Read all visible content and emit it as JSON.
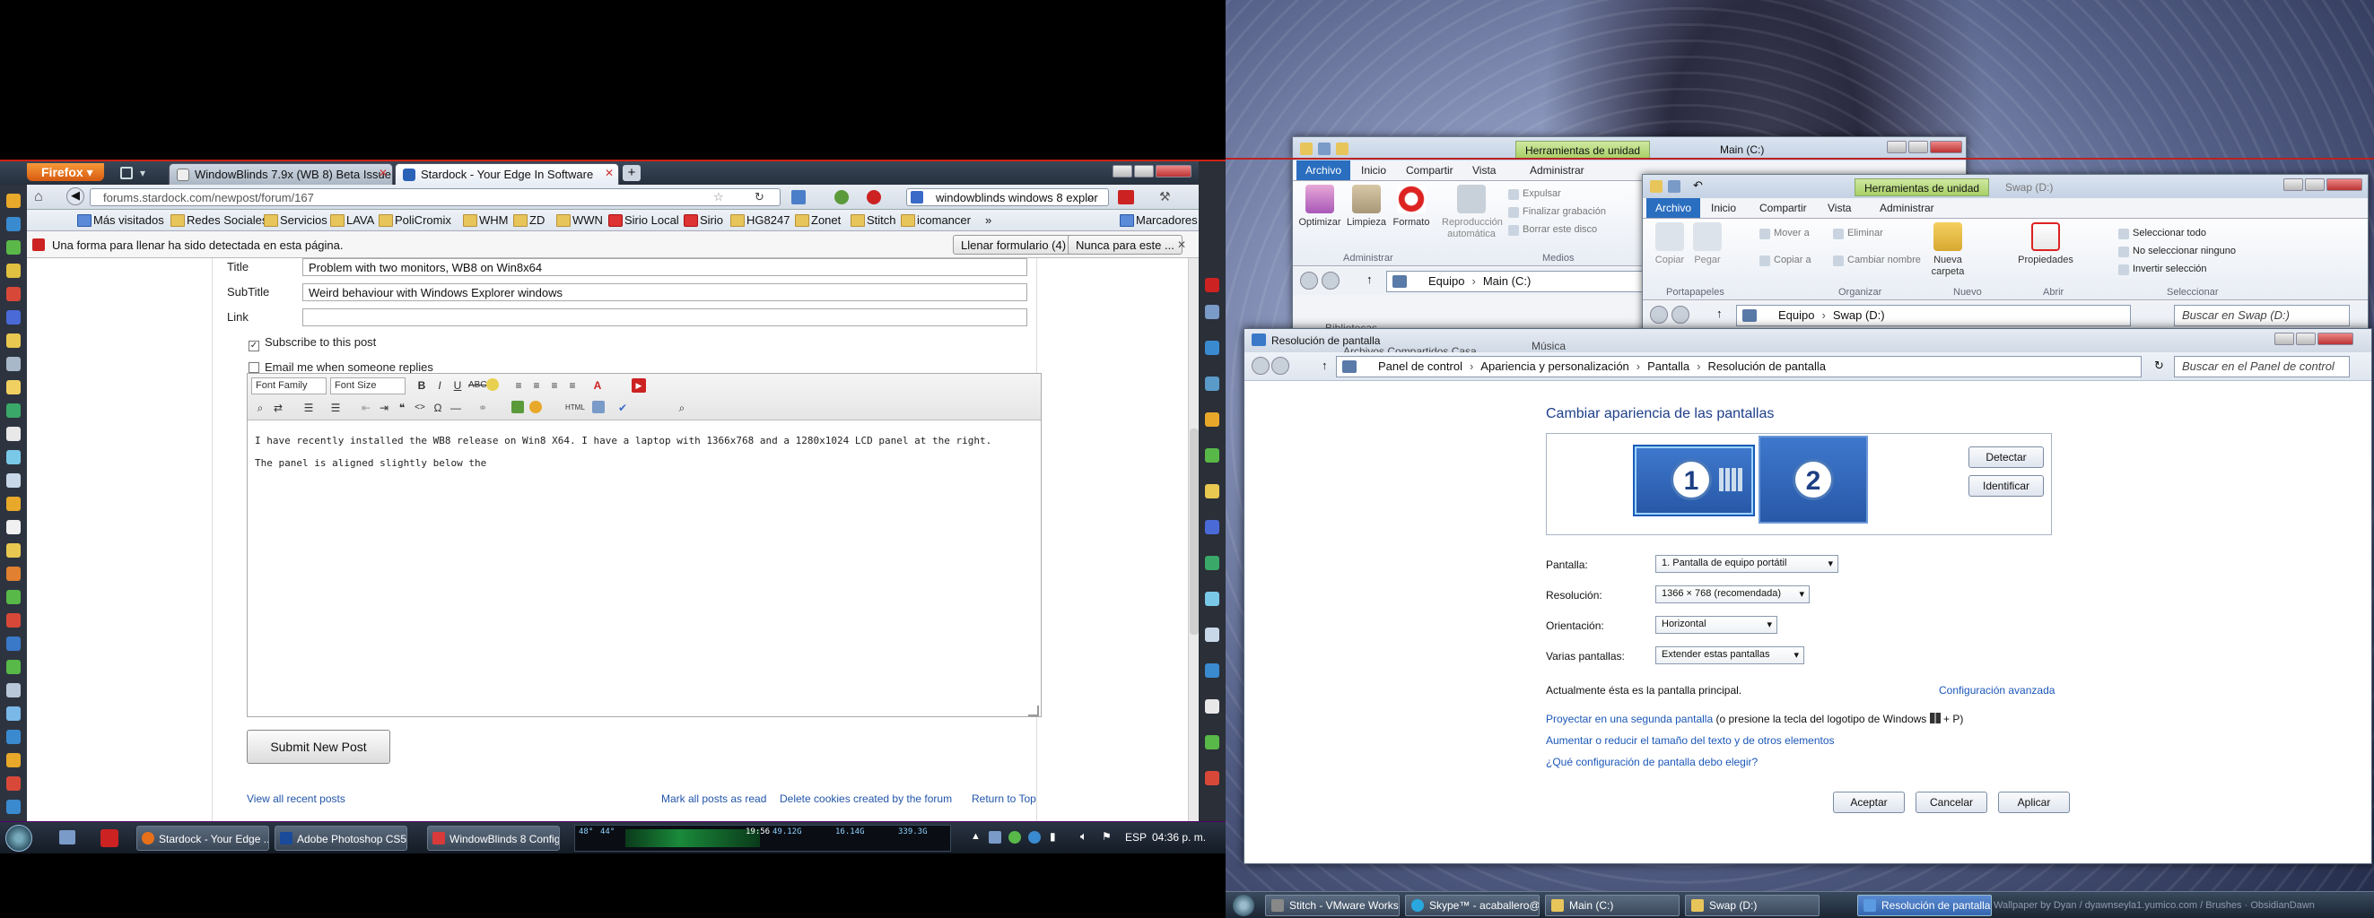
{
  "firefox": {
    "menu_button": "Firefox",
    "tabs": [
      {
        "label": "WindowBlinds 7.9x (WB 8) Beta Issue ..."
      },
      {
        "label": "Stardock - Your Edge In Software"
      }
    ],
    "url": "forums.stardock.com/newpost/forum/167",
    "search_text": "windowblinds windows 8 explor",
    "bookmarks": [
      "Más visitados",
      "Redes Sociales",
      "Servicios",
      "LAVA",
      "PoliCromix",
      "WHM",
      "ZD",
      "WWN",
      "Sirio Local",
      "Sirio",
      "HG8247",
      "Zonet",
      "Stitch",
      "icomancer"
    ],
    "bookmarks_menu": "Marcadores",
    "notification": {
      "text": "Una forma para llenar ha sido detectada en esta página.",
      "fill_button": "Llenar formulario (4)",
      "never_button": "Nunca para este ..."
    },
    "form": {
      "title_label": "Title",
      "title_value": "Problem with two monitors, WB8 on Win8x64",
      "subtitle_label": "SubTitle",
      "subtitle_value": "Weird behaviour with Windows Explorer windows",
      "link_label": "Link",
      "link_value": "",
      "subscribe_label": "Subscribe to this post",
      "email_label": "Email me when someone replies",
      "font_family": "Font Family",
      "font_size": "Font Size",
      "body_line1": "I have recently installed the WB8 release on Win8 X64. I have a laptop with 1366x768 and a 1280x1024 LCD panel at the right.",
      "body_line2": "The panel is aligned slightly below the",
      "submit_label": "Submit New Post",
      "view_all": "View all recent posts",
      "mark_read": "Mark all posts as read",
      "delete_cookies": "Delete cookies created by the forum",
      "return_top": "Return to Top"
    }
  },
  "left_taskbar": {
    "items": [
      {
        "label": "Stardock - Your Edge ..."
      },
      {
        "label": "Adobe Photoshop CS5"
      },
      {
        "label": "WindowBlinds 8 Config..."
      }
    ],
    "meters": [
      "48°",
      "44°",
      "19:56",
      "49.12G",
      "16.14G",
      "339.3G"
    ],
    "lang": "ESP",
    "clock": "04:36 p. m."
  },
  "explorer_main": {
    "contextual": "Herramientas de unidad",
    "title": "Main (C:)",
    "tabs": [
      "Archivo",
      "Inicio",
      "Compartir",
      "Vista",
      "Administrar"
    ],
    "buttons": [
      "Optimizar",
      "Limpieza",
      "Formato",
      "Reproducción automática"
    ],
    "small_buttons": [
      "Expulsar",
      "Finalizar grabación",
      "Borrar este disco"
    ],
    "groups": [
      "Administrar",
      "Medios"
    ],
    "path": [
      "Equipo",
      "Main (C:)"
    ],
    "nav_items": [
      "Bibliotecas",
      "Archivos Compartidos Casa",
      "Música"
    ]
  },
  "explorer_swap": {
    "contextual": "Herramientas de unidad",
    "title": "Swap (D:)",
    "tabs": [
      "Archivo",
      "Inicio",
      "Compartir",
      "Vista",
      "Administrar"
    ],
    "buttons": [
      "Copiar",
      "Pegar",
      "Nueva carpeta",
      "Propiedades"
    ],
    "small_buttons": [
      "Mover a",
      "Copiar a",
      "Eliminar",
      "Cambiar nombre",
      "Seleccionar todo",
      "No seleccionar ninguno",
      "Invertir selección"
    ],
    "groups": [
      "Portapapeles",
      "Organizar",
      "Nuevo",
      "Abrir",
      "Seleccionar"
    ],
    "path": [
      "Equipo",
      "Swap (D:)"
    ],
    "search": "Buscar en Swap (D:)"
  },
  "display_dialog": {
    "title": "Resolución de pantalla",
    "path": [
      "Panel de control",
      "Apariencia y personalización",
      "Pantalla",
      "Resolución de pantalla"
    ],
    "search": "Buscar en el Panel de control",
    "heading": "Cambiar apariencia de las pantallas",
    "detect": "Detectar",
    "identify": "Identificar",
    "monitor1": "1",
    "monitor2": "2",
    "screen_label": "Pantalla:",
    "screen_value": "1. Pantalla de equipo portátil",
    "resolution_label": "Resolución:",
    "resolution_value": "1366 × 768 (recomendada)",
    "orientation_label": "Orientación:",
    "orientation_value": "Horizontal",
    "multi_label": "Varias pantallas:",
    "multi_value": "Extender estas pantallas",
    "primary_text": "Actualmente ésta es la pantalla principal.",
    "advanced_link": "Configuración avanzada",
    "project_link": "Proyectar en una segunda pantalla",
    "project_text": "(o presione la tecla del logotipo de Windows",
    "project_key": "+ P)",
    "text_size_link": "Aumentar o reducir el tamaño del texto y de otros elementos",
    "which_link": "¿Qué configuración de pantalla debo elegir?",
    "ok": "Aceptar",
    "cancel": "Cancelar",
    "apply": "Aplicar"
  },
  "right_taskbar": {
    "items": [
      {
        "label": "Stitch - VMware Works..."
      },
      {
        "label": "Skype™ - acaballero@..."
      },
      {
        "label": "Main (C:)"
      },
      {
        "label": "Swap (D:)"
      },
      {
        "label": "Resolución de pantalla"
      }
    ],
    "wallpaper_credit": "Wallpaper by Dyan / dyawnseyla1.yumico.com / Brushes · ObsidianDawn"
  }
}
